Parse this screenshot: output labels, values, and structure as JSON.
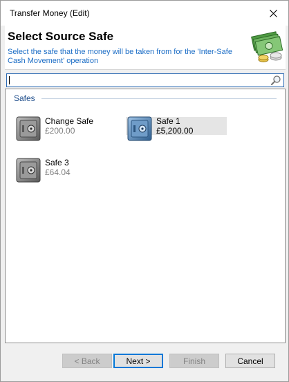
{
  "window": {
    "title": "Transfer Money (Edit)"
  },
  "header": {
    "title": "Select Source Safe",
    "description": "Select the safe that the money will be taken from for the 'Inter-Safe Cash Movement' operation",
    "icon": "money-stack-icon"
  },
  "search": {
    "value": "",
    "placeholder": "",
    "icon": "magnifier-icon"
  },
  "group": {
    "title": "Safes"
  },
  "safes": [
    {
      "name": "Change Safe",
      "amount": "£200.00",
      "selected": false,
      "icon": "safe-icon"
    },
    {
      "name": "Safe 1",
      "amount": "£5,200.00",
      "selected": true,
      "icon": "safe-icon"
    },
    {
      "name": "Safe 3",
      "amount": "£64.04",
      "selected": false,
      "icon": "safe-icon"
    }
  ],
  "buttons": {
    "back": "< Back",
    "next": "Next >",
    "finish": "Finish",
    "cancel": "Cancel"
  },
  "colors": {
    "accent": "#0078d7",
    "description_text": "#1d6ec6",
    "disabled_amount": "#808080"
  }
}
